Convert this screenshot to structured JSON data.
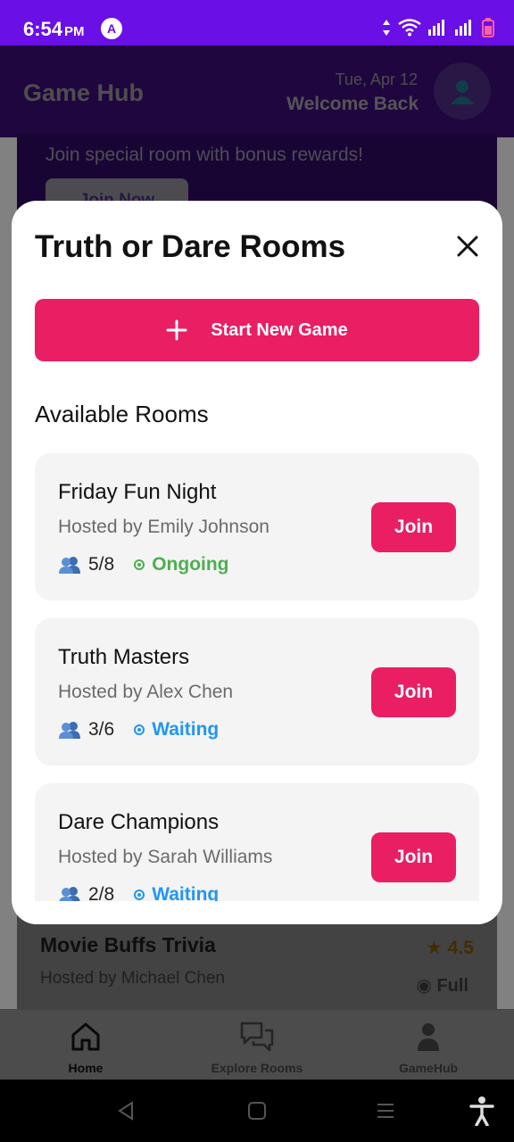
{
  "status_bar": {
    "time": "6:54",
    "ampm": "PM",
    "app_icon_glyph": "A"
  },
  "header": {
    "title": "Game Hub",
    "date": "Tue, Apr 12",
    "welcome": "Welcome Back",
    "avatar_icon": "user-icon"
  },
  "promo": {
    "text": "Join special room with bonus rewards!",
    "button_label": "Join Now"
  },
  "background_card": {
    "title": "Movie Buffs Trivia",
    "host": "Hosted by Michael Chen",
    "rating": "4.5",
    "status": "Full"
  },
  "modal": {
    "title": "Truth or Dare Rooms",
    "start_label": "Start New Game",
    "section_title": "Available Rooms",
    "join_label": "Join",
    "rooms": [
      {
        "name": "Friday Fun Night",
        "host": "Hosted by Emily Johnson",
        "count": "5/8",
        "status": "Ongoing"
      },
      {
        "name": "Truth Masters",
        "host": "Hosted by Alex Chen",
        "count": "3/6",
        "status": "Waiting"
      },
      {
        "name": "Dare Champions",
        "host": "Hosted by Sarah Williams",
        "count": "2/8",
        "status": "Waiting"
      }
    ]
  },
  "bottom_nav": {
    "items": [
      {
        "label": "Home",
        "icon": "home-icon",
        "active": true
      },
      {
        "label": "Explore Rooms",
        "icon": "chat-icon",
        "active": false
      },
      {
        "label": "GameHub",
        "icon": "user-icon",
        "active": false
      }
    ]
  },
  "colors": {
    "accent": "#e91e63",
    "status_bar": "#6a0fe6",
    "header": "#3a0b74",
    "ongoing": "#4caf50",
    "waiting": "#2196f3"
  }
}
